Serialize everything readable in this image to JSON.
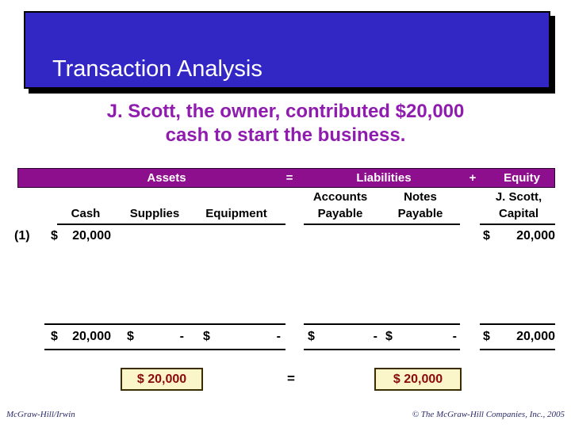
{
  "slide": {
    "title": "Transaction Analysis",
    "subtitle_line1": "J. Scott, the owner, contributed $20,000",
    "subtitle_line2": "cash to start the business.",
    "title_bg_color": "#3226C4",
    "subtitle_color": "#8F1CAE",
    "header_bar_color": "#8E0F8E",
    "summary_box_bg": "#FBF6C9",
    "summary_box_text_color": "#8B0A0A"
  },
  "table": {
    "group_headers": {
      "assets": "Assets",
      "equals": "=",
      "liabilities": "Liabilities",
      "plus": "+",
      "equity": "Equity"
    },
    "column_headers": [
      {
        "top": "",
        "bottom": "Cash"
      },
      {
        "top": "",
        "bottom": "Supplies"
      },
      {
        "top": "",
        "bottom": "Equipment"
      },
      {
        "top": "Accounts",
        "bottom": "Payable"
      },
      {
        "top": "Notes",
        "bottom": "Payable"
      },
      {
        "top": "J. Scott,",
        "bottom": "Capital"
      }
    ],
    "rows": [
      {
        "label": "(1)",
        "cash_sign": "$",
        "cash_value": "20,000",
        "supplies_sign": "",
        "supplies_value": "",
        "equipment_sign": "",
        "equipment_value": "",
        "ap_sign": "",
        "ap_value": "",
        "np_sign": "",
        "np_value": "",
        "capital_sign": "$",
        "capital_value": "20,000"
      }
    ],
    "totals": {
      "cash_sign": "$",
      "cash_value": "20,000",
      "supplies_sign": "$",
      "supplies_value": "-",
      "equipment_sign": "$",
      "equipment_value": "-",
      "ap_sign": "$",
      "ap_value": "-",
      "np_sign": "$",
      "np_value": "-",
      "capital_sign": "$",
      "capital_value": "20,000"
    },
    "summary": {
      "left_box": "$  20,000",
      "equals": "=",
      "right_box": "$    20,000"
    }
  },
  "footer": {
    "left": "McGraw-Hill/Irwin",
    "right": "© The McGraw-Hill Companies, Inc., 2005"
  }
}
